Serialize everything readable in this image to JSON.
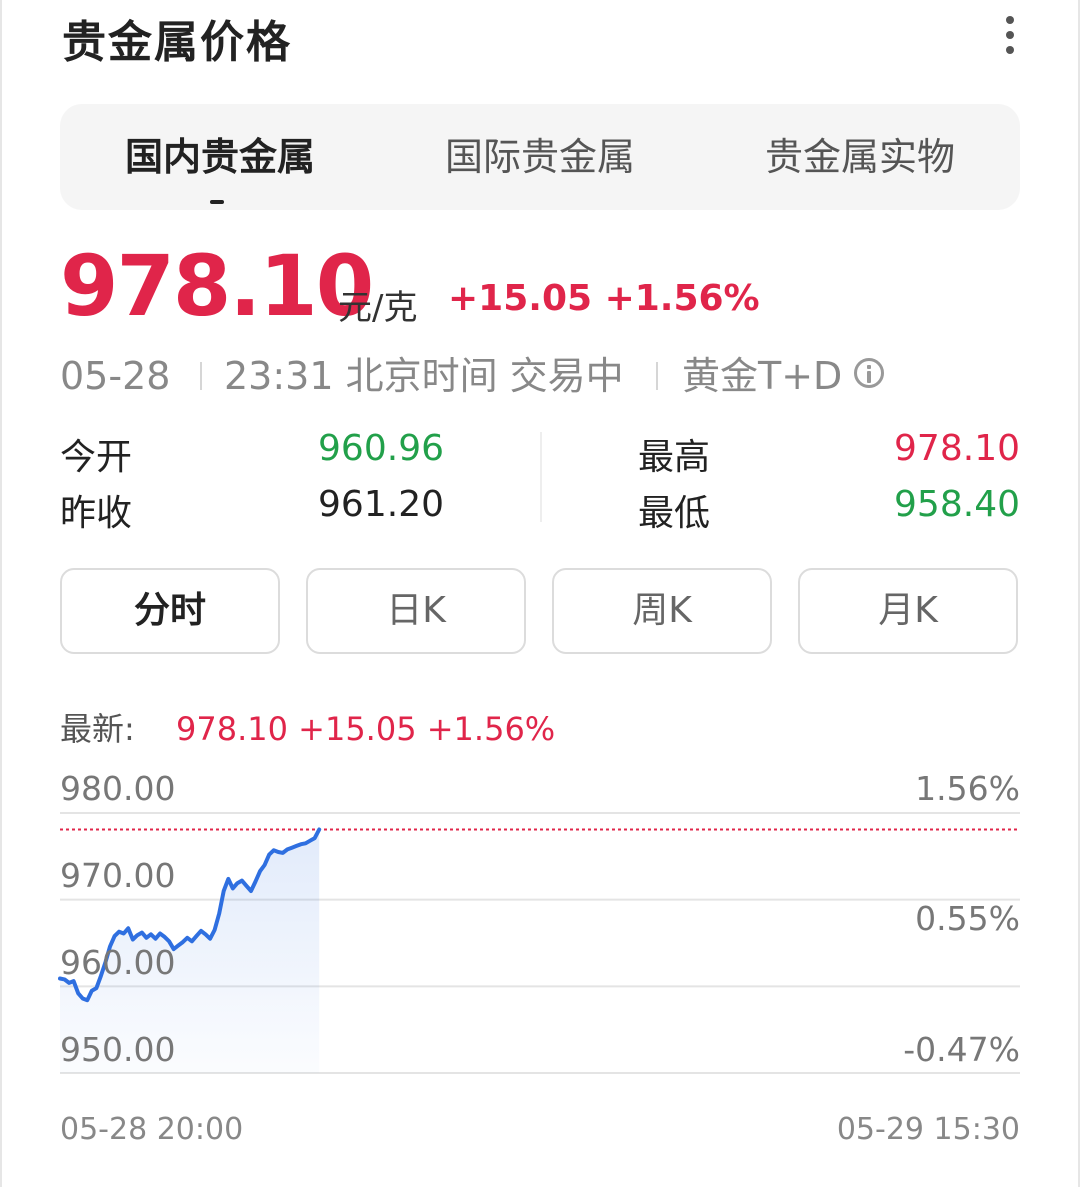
{
  "header": {
    "title": "贵金属价格",
    "more_icon": "more-vertical-icon"
  },
  "tabs": [
    {
      "label": "国内贵金属",
      "active": true
    },
    {
      "label": "国际贵金属",
      "active": false
    },
    {
      "label": "贵金属实物",
      "active": false
    }
  ],
  "quote": {
    "price": "978.10",
    "unit": "元/克",
    "change": "+15.05 +1.56%",
    "date": "05-28",
    "time_status": "23:31 北京时间 交易中",
    "instrument": "黄金T+D",
    "info_icon": "info-icon"
  },
  "stats": {
    "open_label": "今开",
    "open_value": "960.96",
    "prev_close_label": "昨收",
    "prev_close_value": "961.20",
    "high_label": "最高",
    "high_value": "978.10",
    "low_label": "最低",
    "low_value": "958.40"
  },
  "period_tabs": [
    {
      "label": "分时",
      "active": true
    },
    {
      "label": "日K",
      "active": false
    },
    {
      "label": "周K",
      "active": false
    },
    {
      "label": "月K",
      "active": false
    }
  ],
  "latest": {
    "label": "最新:",
    "value": "978.10 +15.05 +1.56%"
  },
  "colors": {
    "up": "#e0254a",
    "down": "#22a04a",
    "line": "#2f6fe0"
  },
  "chart_data": {
    "type": "line",
    "y_labels_left": [
      "980.00",
      "970.00",
      "960.00",
      "950.00"
    ],
    "y_labels_right": [
      "1.56%",
      "0.55%",
      "-0.47%"
    ],
    "ylim": [
      950,
      980
    ],
    "x_start_label": "05-28 20:00",
    "x_end_label": "05-29 15:30",
    "reference_line": 978.1,
    "session_fraction_elapsed": 0.27,
    "values": [
      960.9,
      960.8,
      960.4,
      960.6,
      959.2,
      958.6,
      958.4,
      959.5,
      959.8,
      961.2,
      962.8,
      964.6,
      965.8,
      966.3,
      966.1,
      966.7,
      965.4,
      965.9,
      966.2,
      965.6,
      966.0,
      965.5,
      966.1,
      965.7,
      965.2,
      964.3,
      964.7,
      965.1,
      965.6,
      965.2,
      965.8,
      966.4,
      966.0,
      965.5,
      966.5,
      968.4,
      971.0,
      972.4,
      971.3,
      971.9,
      972.2,
      971.6,
      971.0,
      972.1,
      973.3,
      974.0,
      975.2,
      975.7,
      975.5,
      975.4,
      975.8,
      976.0,
      976.2,
      976.4,
      976.5,
      976.8,
      977.1,
      978.1
    ]
  }
}
